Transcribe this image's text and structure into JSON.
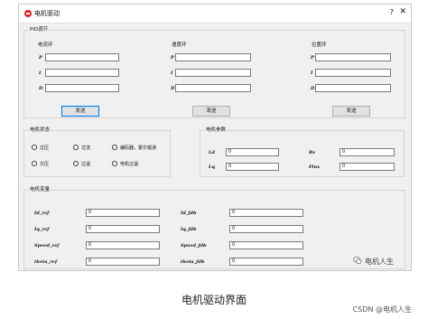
{
  "window": {
    "title": "电机驱动",
    "help_label": "?",
    "close_label": "✕"
  },
  "pid": {
    "group_label": "PID调节",
    "send_label": "发送",
    "loops": [
      {
        "title": "电流环",
        "p_label": "P",
        "i_label": "I",
        "d_label": "D",
        "p_value": "",
        "i_value": "",
        "d_value": ""
      },
      {
        "title": "速度环",
        "p_label": "P",
        "i_label": "I",
        "d_label": "D",
        "p_value": "",
        "i_value": "",
        "d_value": ""
      },
      {
        "title": "位置环",
        "p_label": "P",
        "i_label": "I",
        "d_label": "D",
        "p_value": "",
        "i_value": "",
        "d_value": ""
      }
    ]
  },
  "status": {
    "group_label": "电机状态",
    "items": [
      "过压",
      "过流",
      "编码器，霍尔错误",
      "欠压",
      "过温",
      "电机过温"
    ]
  },
  "params": {
    "group_label": "电机参数",
    "ld_label": "Ld",
    "ld_value": "0",
    "rs_label": "Rs",
    "rs_value": "0",
    "lq_label": "Lq",
    "lq_value": "0",
    "flux_label": "Flux",
    "flux_value": "0"
  },
  "vars": {
    "group_label": "电机变量",
    "rows": [
      {
        "ref_label": "Id_ref",
        "ref_value": "0",
        "fdb_label": "Id_fdb",
        "fdb_value": "0"
      },
      {
        "ref_label": "Iq_ref",
        "ref_value": "0",
        "fdb_label": "Iq_fdb",
        "fdb_value": "0"
      },
      {
        "ref_label": "Speed_ref",
        "ref_value": "0",
        "fdb_label": "Speed_fdb",
        "fdb_value": "0"
      },
      {
        "ref_label": "theta_ref",
        "ref_value": "0",
        "fdb_label": "theta_fdb",
        "fdb_value": "0"
      }
    ]
  },
  "watermark": "电机人生",
  "caption": "电机驱动界面",
  "csdn_credit": "CSDN @电机人生",
  "colors": {
    "app_icon": "#e81e25",
    "focus_border": "#0078d7"
  }
}
